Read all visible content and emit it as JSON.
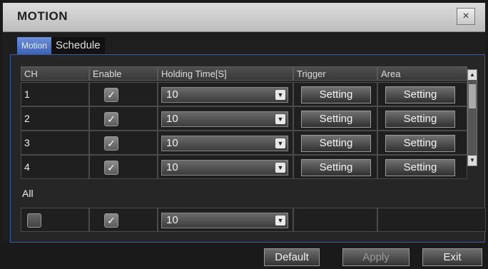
{
  "window": {
    "title": "MOTION",
    "close_icon": "×"
  },
  "tabs": [
    {
      "label": "Motion",
      "active": true
    },
    {
      "label": "Schedule",
      "active": false
    }
  ],
  "table": {
    "headers": [
      "CH",
      "Enable",
      "Holding Time[S]",
      "Trigger",
      "Area"
    ],
    "rows": [
      {
        "ch": "1",
        "enabled": true,
        "holding_time": "10",
        "trigger": "Setting",
        "area": "Setting"
      },
      {
        "ch": "2",
        "enabled": true,
        "holding_time": "10",
        "trigger": "Setting",
        "area": "Setting"
      },
      {
        "ch": "3",
        "enabled": true,
        "holding_time": "10",
        "trigger": "Setting",
        "area": "Setting"
      },
      {
        "ch": "4",
        "enabled": true,
        "holding_time": "10",
        "trigger": "Setting",
        "area": "Setting"
      }
    ]
  },
  "all": {
    "label": "All",
    "select_all": false,
    "enabled": true,
    "holding_time": "10"
  },
  "footer": {
    "default_label": "Default",
    "apply_label": "Apply",
    "exit_label": "Exit"
  },
  "icons": {
    "check": "check-icon",
    "dropdown": "chevron-down-icon",
    "close": "close-icon"
  },
  "colors": {
    "accent": "#3d63b8",
    "border": "#3d5aa8"
  }
}
